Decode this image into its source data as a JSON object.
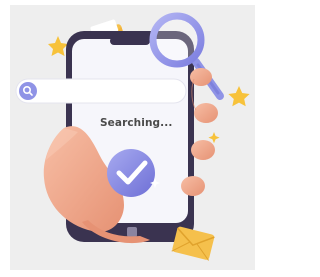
{
  "status_text": "Searching...",
  "icons": [
    "search-bar-icon",
    "magnifying-glass-icon",
    "checkmark-badge-icon",
    "envelope-icon",
    "star-icon",
    "sparkle-icon",
    "hand-icon",
    "smartphone-icon"
  ],
  "colors": {
    "background": "#eeeeee",
    "phone_body": "#3a3350",
    "screen": "#f6f6fb",
    "accent": "#8f93e6",
    "accent_dark": "#6f70d4",
    "skin": "#f2a98d",
    "skin_shadow": "#e28f72",
    "star": "#f7c23a",
    "envelope": "#f5c04c"
  }
}
